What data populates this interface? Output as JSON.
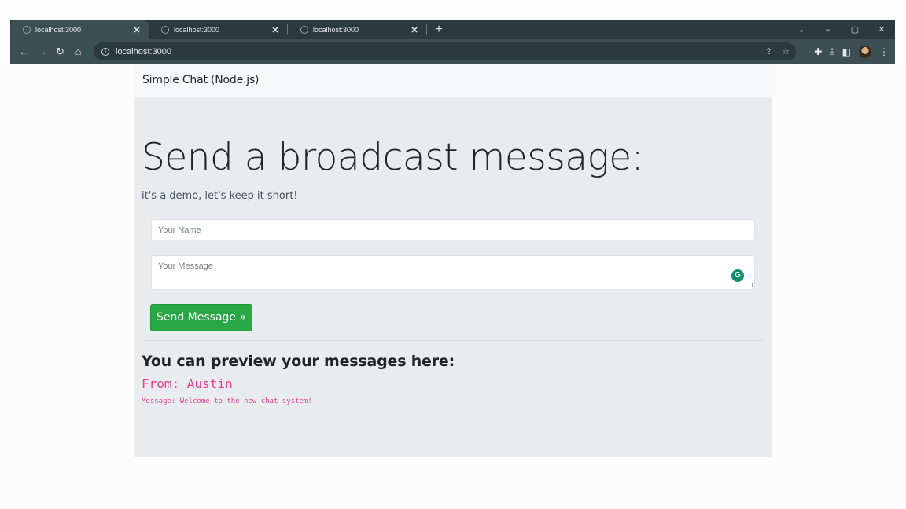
{
  "browser": {
    "tabs": [
      {
        "title": "localhost:3000",
        "active": true
      },
      {
        "title": "localhost:3000",
        "active": false
      },
      {
        "title": "localhost:3000",
        "active": false
      }
    ],
    "tab_close_glyph": "✕",
    "new_tab_glyph": "+",
    "address": "localhost:3000",
    "window_controls": {
      "chevron": "⌄",
      "minimize": "–",
      "restore": "▢",
      "close": "✕"
    },
    "toolbar_icons": [
      "back-icon",
      "forward-icon",
      "reload-icon",
      "home-icon",
      "share-icon",
      "star-icon",
      "extensions-icon",
      "download-icon",
      "sidepanel-icon",
      "profile-avatar",
      "menu-icon"
    ]
  },
  "navbar": {
    "brand": "Simple Chat (Node.js)"
  },
  "hero": {
    "title": "Send a broadcast message:",
    "subtitle": "it's a demo, let's keep it short!"
  },
  "form": {
    "name_placeholder": "Your Name",
    "message_placeholder": "Your Message",
    "send_label": "Send Message »"
  },
  "preview": {
    "title": "You can preview your messages here:",
    "from": "From: Austin",
    "message": "Message: Welcome to the new chat system!"
  },
  "colors": {
    "accent_green": "#28a745",
    "message_pink": "#e83e8c",
    "jumbotron_bg": "#e9ecef"
  }
}
